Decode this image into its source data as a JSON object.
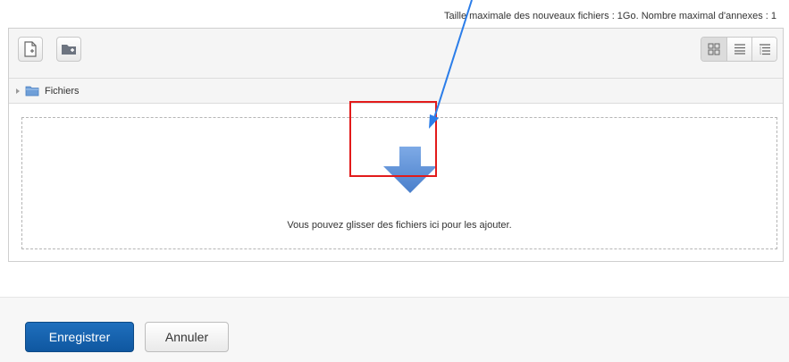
{
  "limits": {
    "text": "Taille maximale des nouveaux fichiers : 1Go. Nombre maximal d'annexes : 1"
  },
  "toolbar": {
    "add_icon": "add-file-icon",
    "folder_icon": "create-folder-icon",
    "views": [
      "icons-view-icon",
      "list-view-icon",
      "tree-view-icon"
    ]
  },
  "path": {
    "label": "Fichiers"
  },
  "dropzone": {
    "text": "Vous pouvez glisser des fichiers ici pour les ajouter.",
    "arrow_color": "#5b8fd4",
    "highlight_color": "#e21b1b"
  },
  "footer": {
    "save_label": "Enregistrer",
    "cancel_label": "Annuler"
  },
  "colors": {
    "primary": "#1563b0",
    "annotation_arrow": "#2b7de9"
  }
}
